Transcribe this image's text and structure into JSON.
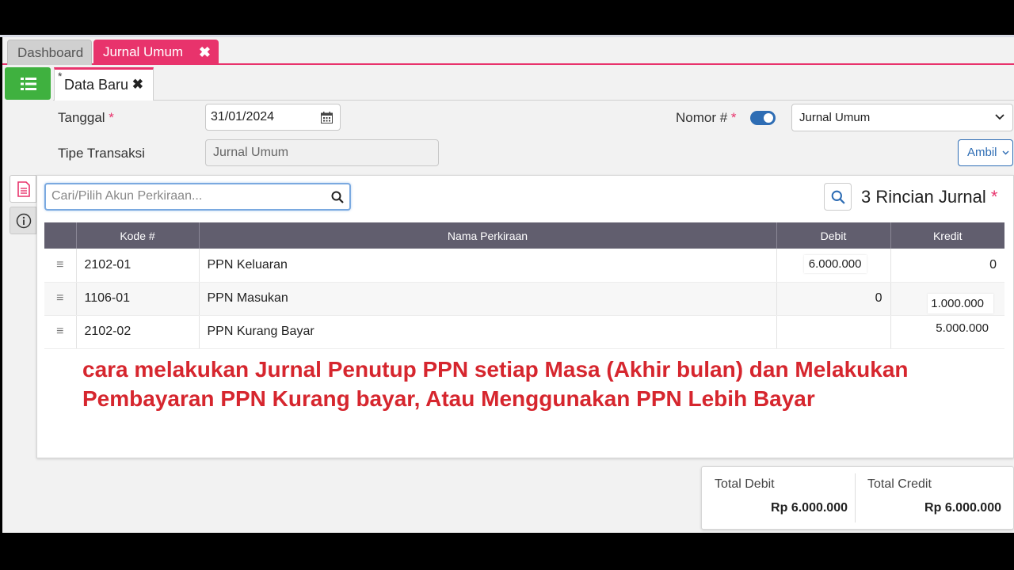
{
  "tabs": {
    "dashboard": "Dashboard",
    "jurnal": "Jurnal Umum",
    "close": "✖"
  },
  "subtab": {
    "star": "*",
    "label": "Data Baru",
    "close": "✖"
  },
  "form": {
    "tanggal_label": "Tanggal",
    "tanggal_value": "31/01/2024",
    "required": "*",
    "tipe_label": "Tipe Transaksi",
    "tipe_value": "Jurnal Umum",
    "nomor_label": "Nomor #",
    "nomor_select": "Jurnal Umum",
    "ambil_label": "Ambil"
  },
  "panel": {
    "search_placeholder": "Cari/Pilih Akun Perkiraan...",
    "rincian": "3 Rincian Jurnal",
    "columns": [
      "Kode #",
      "Nama Perkiraan",
      "Debit",
      "Kredit"
    ],
    "rows": [
      {
        "kode": "2102-01",
        "nama": "PPN Keluaran",
        "debit": "6.000.000",
        "kredit": "0"
      },
      {
        "kode": "1106-01",
        "nama": "PPN Masukan",
        "debit": "0",
        "kredit": "1.000.000"
      },
      {
        "kode": "2102-02",
        "nama": "PPN Kurang Bayar",
        "debit": "",
        "kredit": "5.000.000"
      }
    ]
  },
  "overlay_text": "cara melakukan Jurnal Penutup PPN setiap Masa (Akhir bulan) dan Melakukan Pembayaran PPN Kurang bayar, Atau Menggunakan PPN Lebih Bayar",
  "totals": {
    "debit_label": "Total Debit",
    "debit_value": "Rp 6.000.000",
    "credit_label": "Total Credit",
    "credit_value": "Rp 6.000.000"
  },
  "icons": [
    "list-icon",
    "calendar-icon",
    "toggle-switch",
    "chevron-down-icon",
    "document-icon",
    "info-icon",
    "search-icon",
    "drag-handle-icon"
  ],
  "colors": {
    "accent": "#e8336c",
    "green": "#3fb13f",
    "blue": "#2e6db4",
    "header": "#615e6e",
    "overlay": "#d6262e"
  }
}
